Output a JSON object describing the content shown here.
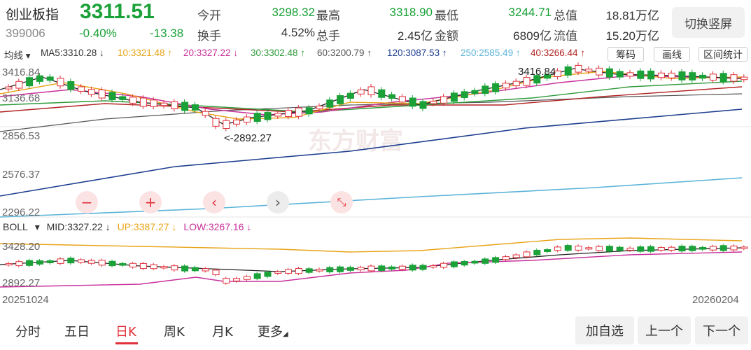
{
  "header": {
    "name": "创业板指",
    "price": "3311.51",
    "code": "399006",
    "pct": "-0.40%",
    "change": "-13.38",
    "stats": [
      {
        "label": "今开",
        "value": "3298.32",
        "color": "green"
      },
      {
        "label": "最高",
        "value": "3318.90",
        "color": "green"
      },
      {
        "label": "最低",
        "value": "3244.71",
        "color": "green"
      },
      {
        "label": "总值",
        "value": "18.81万亿",
        "color": "dark"
      },
      {
        "label": "换手",
        "value": "4.52%",
        "color": "dark"
      },
      {
        "label": "总手",
        "value": "2.45亿",
        "color": "dark"
      },
      {
        "label": "金额",
        "value": "6809亿",
        "color": "dark"
      },
      {
        "label": "流值",
        "value": "15.20万亿",
        "color": "dark"
      }
    ],
    "portrait_button": "切换竖屏"
  },
  "ma_legend": {
    "selector": "均线",
    "items": [
      {
        "text": "MA5:3310.28 ↓",
        "color": "#333333"
      },
      {
        "text": "10:3321.48 ↑",
        "color": "#e8a317"
      },
      {
        "text": "20:3327.22 ↓",
        "color": "#c8309a"
      },
      {
        "text": "30:3302.48 ↑",
        "color": "#2e9a3a"
      },
      {
        "text": "60:3200.79 ↑",
        "color": "#555555"
      },
      {
        "text": "120:3087.53 ↑",
        "color": "#1e3f8f"
      },
      {
        "text": "250:2585.49 ↑",
        "color": "#5bb4d8"
      },
      {
        "text": "40:3266.44 ↑",
        "color": "#b22222"
      }
    ],
    "buttons": [
      "筹码",
      "画线",
      "区间统计"
    ]
  },
  "main_chart": {
    "y_labels": [
      "3416.84",
      "3136.68",
      "2856.53",
      "2576.37",
      "2296.22"
    ],
    "high_marker": "3416.84",
    "low_marker": "<-2892.27",
    "watermark": "东方财富",
    "controls": [
      {
        "icon": "minus-icon",
        "glyph": "−"
      },
      {
        "icon": "plus-icon",
        "glyph": "+"
      },
      {
        "icon": "chevron-left-icon",
        "glyph": "‹"
      },
      {
        "icon": "chevron-right-icon",
        "glyph": "›"
      },
      {
        "icon": "collapse-icon",
        "glyph": "⤡"
      }
    ]
  },
  "boll": {
    "selector": "BOLL",
    "mid": "MID:3327.22 ↓",
    "up": "UP:3387.27 ↓",
    "low": "LOW:3267.16 ↓",
    "y_labels": [
      "3428.20",
      "2892.27"
    ],
    "mid_color": "#333333",
    "up_color": "#e8a317",
    "low_color": "#c8309a"
  },
  "date_start": "20251024",
  "date_end": "20260204",
  "tabs": [
    {
      "label": "分时",
      "active": false
    },
    {
      "label": "五日",
      "active": false
    },
    {
      "label": "日K",
      "active": true
    },
    {
      "label": "周K",
      "active": false
    },
    {
      "label": "月K",
      "active": false
    },
    {
      "label": "更多",
      "active": false
    }
  ],
  "bottom_buttons": [
    "加自选",
    "上一个",
    "下一个"
  ],
  "colors": {
    "up": "#e0303a",
    "down": "#1aa138",
    "accent": "#e0303a"
  }
}
